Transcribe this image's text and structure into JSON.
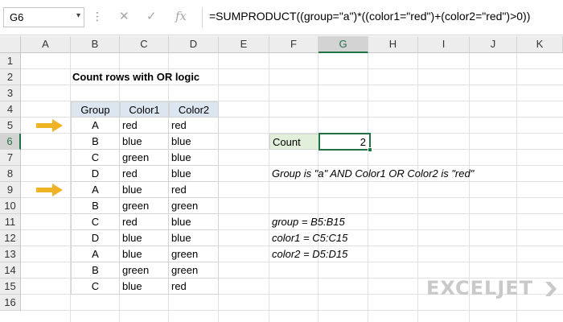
{
  "formula_bar": {
    "name_box": "G6",
    "name_box_arrow": "▾",
    "separator": "⋮",
    "cancel_icon": "✕",
    "enter_icon": "✓",
    "fx_label": "fx",
    "formula": "=SUMPRODUCT((group=\"a\")*((color1=\"red\")+(color2=\"red\")>0))"
  },
  "grid": {
    "columns": [
      "A",
      "B",
      "C",
      "D",
      "E",
      "F",
      "G",
      "H",
      "I",
      "J",
      "K"
    ],
    "rows": [
      "1",
      "2",
      "3",
      "4",
      "5",
      "6",
      "7",
      "8",
      "9",
      "10",
      "11",
      "12",
      "13",
      "14",
      "15",
      "16"
    ],
    "active_column": "G",
    "active_row": "6"
  },
  "sheet": {
    "title": "Count rows with OR logic",
    "table": {
      "headers": [
        "Group",
        "Color1",
        "Color2"
      ],
      "rows": [
        [
          "A",
          "red",
          "red"
        ],
        [
          "B",
          "blue",
          "blue"
        ],
        [
          "C",
          "green",
          "blue"
        ],
        [
          "D",
          "red",
          "blue"
        ],
        [
          "A",
          "blue",
          "red"
        ],
        [
          "B",
          "green",
          "green"
        ],
        [
          "C",
          "red",
          "blue"
        ],
        [
          "D",
          "blue",
          "blue"
        ],
        [
          "A",
          "blue",
          "green"
        ],
        [
          "B",
          "green",
          "green"
        ],
        [
          "C",
          "blue",
          "red"
        ]
      ]
    },
    "count_label": "Count",
    "count_value": "2",
    "note": "Group is \"a\" AND Color1 OR Color2 is \"red\"",
    "named_ranges": [
      "group = B5:B15",
      "color1 = C5:C15",
      "color2 = D5:D15"
    ]
  },
  "colors": {
    "accent": "#217346",
    "arrow": "#f0b323",
    "header_fill": "#dce6f1",
    "label_fill": "#e2efda"
  },
  "logo": {
    "text": "EXCELJET",
    "icon": "exceljet-mark-icon"
  }
}
